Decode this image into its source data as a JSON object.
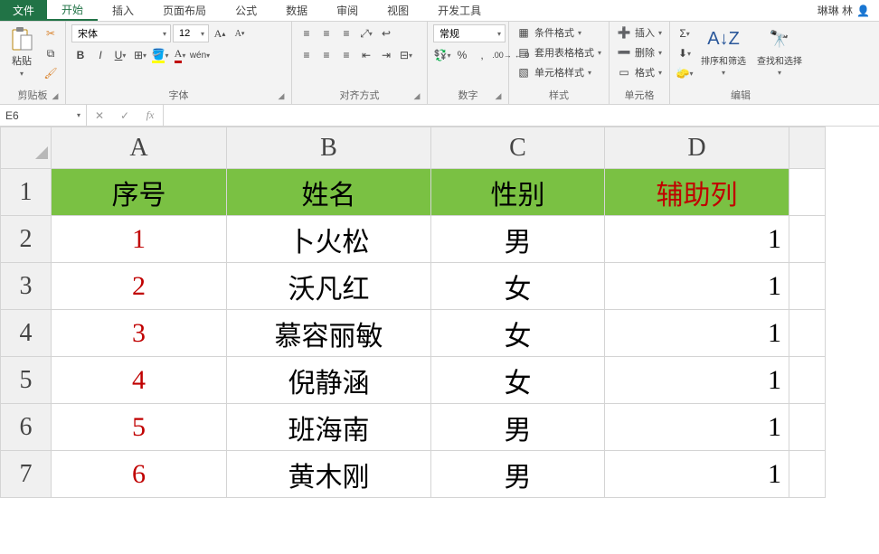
{
  "user_name": "琳琳 林",
  "menu": {
    "file": "文件",
    "tabs": [
      "开始",
      "插入",
      "页面布局",
      "公式",
      "数据",
      "审阅",
      "视图",
      "开发工具"
    ]
  },
  "ribbon": {
    "clipboard": {
      "paste": "粘贴",
      "label": "剪贴板"
    },
    "font": {
      "name": "宋体",
      "size": "12",
      "label": "字体",
      "pinyin": "wén"
    },
    "alignment": {
      "label": "对齐方式"
    },
    "number": {
      "format": "常规",
      "label": "数字"
    },
    "styles": {
      "cond_fmt": "条件格式",
      "table_fmt": "套用表格格式",
      "cell_styles": "单元格样式",
      "label": "样式"
    },
    "cells": {
      "insert": "插入",
      "delete": "删除",
      "format": "格式",
      "label": "单元格"
    },
    "editing": {
      "sort_filter": "排序和筛选",
      "find_select": "查找和选择",
      "label": "编辑"
    }
  },
  "formula_bar": {
    "cell_ref": "E6",
    "fx": "fx"
  },
  "grid": {
    "col_headers": [
      "A",
      "B",
      "C",
      "D"
    ],
    "row_headers": [
      "1",
      "2",
      "3",
      "4",
      "5",
      "6",
      "7"
    ],
    "header_row": {
      "a": "序号",
      "b": "姓名",
      "c": "性别",
      "d": "辅助列"
    },
    "rows": [
      {
        "seq": "1",
        "name": "卜火松",
        "gender": "男",
        "aux": "1"
      },
      {
        "seq": "2",
        "name": "沃凡红",
        "gender": "女",
        "aux": "1"
      },
      {
        "seq": "3",
        "name": "慕容丽敏",
        "gender": "女",
        "aux": "1"
      },
      {
        "seq": "4",
        "name": "倪静涵",
        "gender": "女",
        "aux": "1"
      },
      {
        "seq": "5",
        "name": "班海南",
        "gender": "男",
        "aux": "1"
      },
      {
        "seq": "6",
        "name": "黄木刚",
        "gender": "男",
        "aux": "1"
      }
    ]
  }
}
